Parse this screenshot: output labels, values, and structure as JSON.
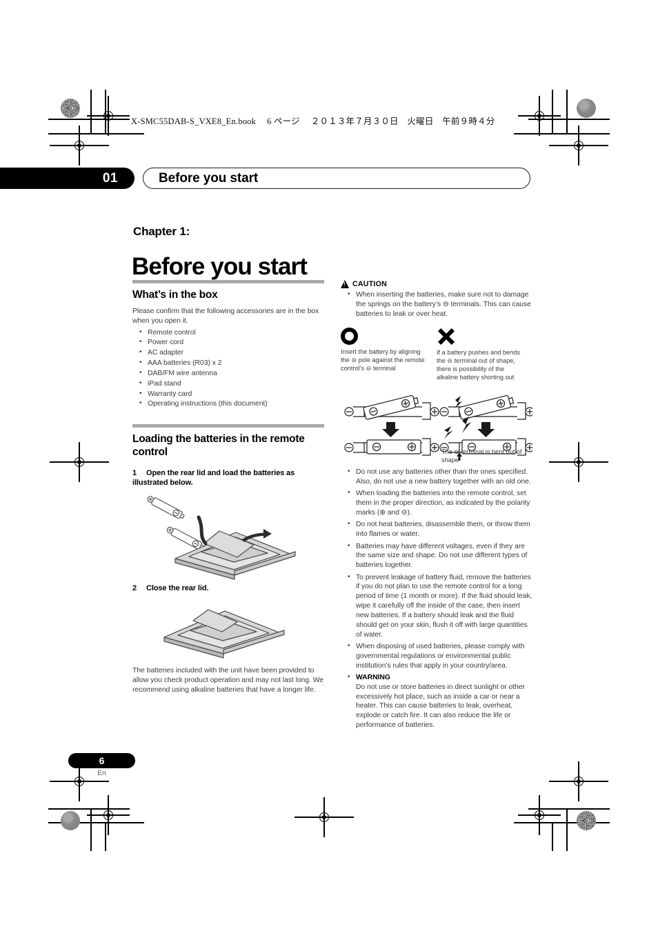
{
  "print_marks": {
    "book_header": "X-SMC55DAB-S_VXE8_En.book 　6 ページ 　２０１３年７月３０日　火曜日　午前９時４分"
  },
  "running_head": {
    "chapter_number": "01",
    "chapter_label": "Before you start"
  },
  "title": {
    "eyebrow": "Chapter 1:",
    "heading": "Before you start"
  },
  "left_column": {
    "whats_in_box": {
      "heading": "What’s in the box",
      "intro": "Please confirm that the following accessories are in the box when you open it.",
      "items": [
        "Remote control",
        "Power cord",
        "AC adapter",
        "AAA batteries (R03) x 2",
        "DAB/FM wire antenna",
        "iPad stand",
        "Warranty card",
        "Operating instructions (this document)"
      ]
    },
    "loading_batteries": {
      "heading": "Loading the batteries in the remote control",
      "step1_num": "1",
      "step1_text": "Open the rear lid and load the batteries as illustrated below.",
      "step2_num": "2",
      "step2_text": "Close the rear lid.",
      "note": "The batteries included with the unit have been provided to allow you check product operation and may not last long. We recommend using alkaline batteries that have a longer life."
    }
  },
  "right_column": {
    "caution": {
      "label": "CAUTION",
      "items": [
        "When inserting the batteries, make sure not to damage the springs on the battery’s ⊖ terminals. This can cause batteries to leak or over heat."
      ]
    },
    "symbols": [
      {
        "symbol": "circle",
        "caption": "Insert the battery by aligning the ⊖ pole against the remote control’s ⊖ terminal"
      },
      {
        "symbol": "cross",
        "caption": "If a battery pushes and bends the ⊖ terminal out of shape, there is possibility of the alkaline battery shorting out"
      }
    ],
    "diagram_caption": "The ⊖ terminal is bent out of shape",
    "diagram_labels": {
      "minus": "⊖",
      "plus": "⊕"
    },
    "notes": [
      "Do not use any batteries other than the ones specified. Also, do not use a new battery together with an old one.",
      "When loading the batteries into the remote control, set them in the proper direction, as indicated by the polarity marks (⊕ and ⊖).",
      "Do not heat batteries, disassemble them, or throw them into flames or water.",
      "Batteries may have different voltages, even if they are the same size and shape. Do not use different types of batteries together.",
      "To prevent leakage of battery fluid, remove the batteries if you do not plan to use the remote control for a long period of time (1 month or more). If the fluid should leak, wipe it carefully off the inside of the case, then insert new batteries. If a battery should leak and the fluid should get on your skin, flush it off with large quantities of water.",
      "When disposing of used batteries, please comply with governmental regulations or environmental public institution’s rules that apply in your country/area."
    ],
    "warning": {
      "label": "WARNING",
      "text": "Do not use or store batteries in direct sunlight or other excessively hot place, such as inside a car or near a heater. This can cause batteries to leak, overheat, explode or catch fire. It can also reduce the life or performance of batteries."
    }
  },
  "footer": {
    "page_number": "6",
    "language": "En"
  }
}
